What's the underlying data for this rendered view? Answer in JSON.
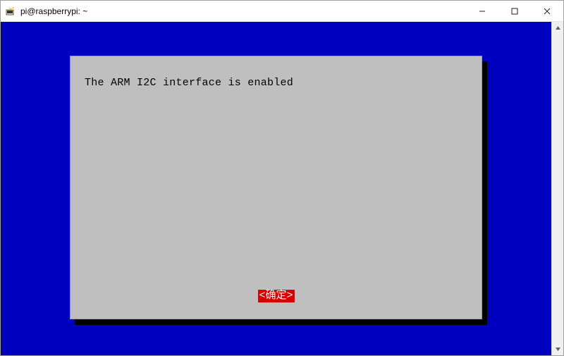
{
  "window": {
    "title": "pi@raspberrypi: ~"
  },
  "dialog": {
    "message": "The ARM I2C interface is enabled",
    "ok_label": "<确定>"
  }
}
